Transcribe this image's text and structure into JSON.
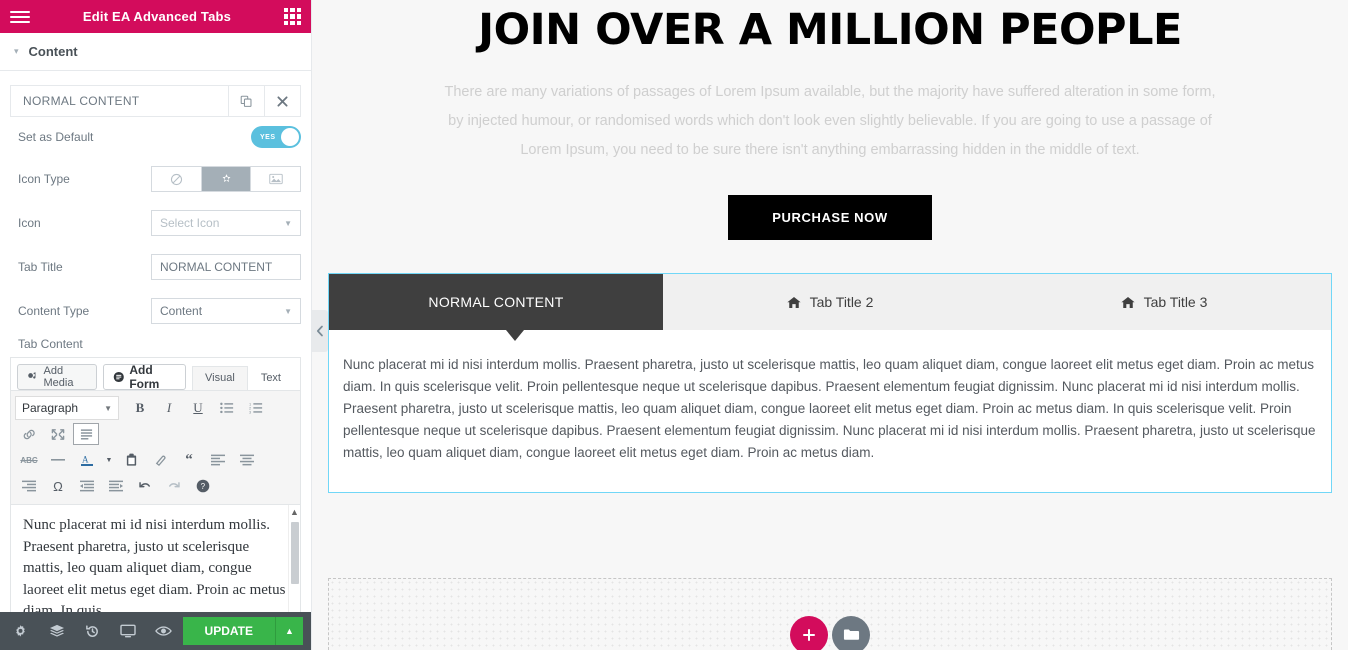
{
  "panel": {
    "header": {
      "title": "Edit EA Advanced Tabs",
      "menu_icon": "hamburger-icon",
      "widgets_icon": "grid-icon"
    },
    "section": {
      "label": "Content",
      "caret": "▾"
    },
    "repeater": {
      "title": "NORMAL CONTENT",
      "duplicate_icon": "copy-icon",
      "remove_icon": "close-icon"
    },
    "controls": {
      "set_as_default": {
        "label": "Set as Default",
        "value": "YES"
      },
      "icon_type": {
        "label": "Icon Type",
        "options": [
          "none",
          "icon",
          "image"
        ],
        "selected": "icon"
      },
      "icon": {
        "label": "Icon",
        "placeholder": "Select Icon",
        "value": ""
      },
      "tab_title": {
        "label": "Tab Title",
        "value": "NORMAL CONTENT"
      },
      "content_type": {
        "label": "Content Type",
        "value": "Content"
      },
      "tab_content": {
        "label": "Tab Content"
      }
    },
    "editor": {
      "add_media": "Add Media",
      "add_form": "Add Form",
      "tabs": [
        "Visual",
        "Text"
      ],
      "active_tab": "Visual",
      "format_select": "Paragraph",
      "toolbar_row1": [
        "bold",
        "italic",
        "underline",
        "bulleted-list",
        "numbered-list"
      ],
      "toolbar_row2": [
        "link",
        "fullscreen",
        "toolbar-toggle"
      ],
      "toolbar_row3": [
        "strikethrough",
        "horizontal-rule",
        "text-color",
        "text-color-arrow",
        "paste-as-text",
        "clear-formatting",
        "blockquote",
        "align-left",
        "align-center"
      ],
      "toolbar_row4": [
        "align-right",
        "special-character",
        "outdent",
        "indent",
        "undo",
        "redo",
        "keyboard-shortcuts"
      ],
      "content": "Nunc placerat mi id nisi interdum mollis. Praesent pharetra, justo ut scelerisque mattis, leo quam aliquet diam, congue laoreet elit metus eget diam. Proin ac metus diam. In quis"
    },
    "footer": {
      "settings_icon": "gear-icon",
      "navigator_icon": "layers-icon",
      "history_icon": "history-icon",
      "responsive_icon": "monitor-icon",
      "preview_icon": "eye-icon",
      "update_label": "UPDATE",
      "update_caret": "▲"
    }
  },
  "preview": {
    "collapse_icon": "chevron-left-icon",
    "hero": {
      "heading": "JOIN OVER A MILLION PEOPLE",
      "paragraph": "There are many variations of passages of Lorem Ipsum available, but the majority have suffered alteration in some form, by injected humour, or randomised words which don't look even slightly believable. If you are going to use a passage of Lorem Ipsum, you need to be sure there isn't anything embarrassing hidden in the middle of text.",
      "button": "PURCHASE NOW"
    },
    "widget": {
      "tabs": [
        {
          "label": "NORMAL CONTENT",
          "icon": "",
          "active": true
        },
        {
          "label": "Tab Title 2",
          "icon": "home-icon",
          "active": false
        },
        {
          "label": "Tab Title 3",
          "icon": "home-icon",
          "active": false
        }
      ],
      "content": "Nunc placerat mi id nisi interdum mollis. Praesent pharetra, justo ut scelerisque mattis, leo quam aliquet diam, congue laoreet elit metus eget diam. Proin ac metus diam. In quis scelerisque velit. Proin pellentesque neque ut scelerisque dapibus. Praesent elementum feugiat dignissim. Nunc placerat mi id nisi interdum mollis. Praesent pharetra, justo ut scelerisque mattis, leo quam aliquet diam, congue laoreet elit metus eget diam. Proin ac metus diam. In quis scelerisque velit. Proin pellentesque neque ut scelerisque dapibus. Praesent elementum feugiat dignissim. Nunc placerat mi id nisi interdum mollis. Praesent pharetra, justo ut scelerisque mattis, leo quam aliquet diam, congue laoreet elit metus eget diam. Proin ac metus diam."
    },
    "add_section": {
      "add_icon": "plus-icon",
      "template_icon": "folder-icon"
    }
  },
  "colors": {
    "brand_pink": "#d30c5c",
    "update_green": "#39b54a",
    "toggle_blue": "#5bc0de",
    "selection_blue": "#71d7f7",
    "footer_dark": "#495157",
    "tab_active_dark": "#3f3f3f"
  }
}
